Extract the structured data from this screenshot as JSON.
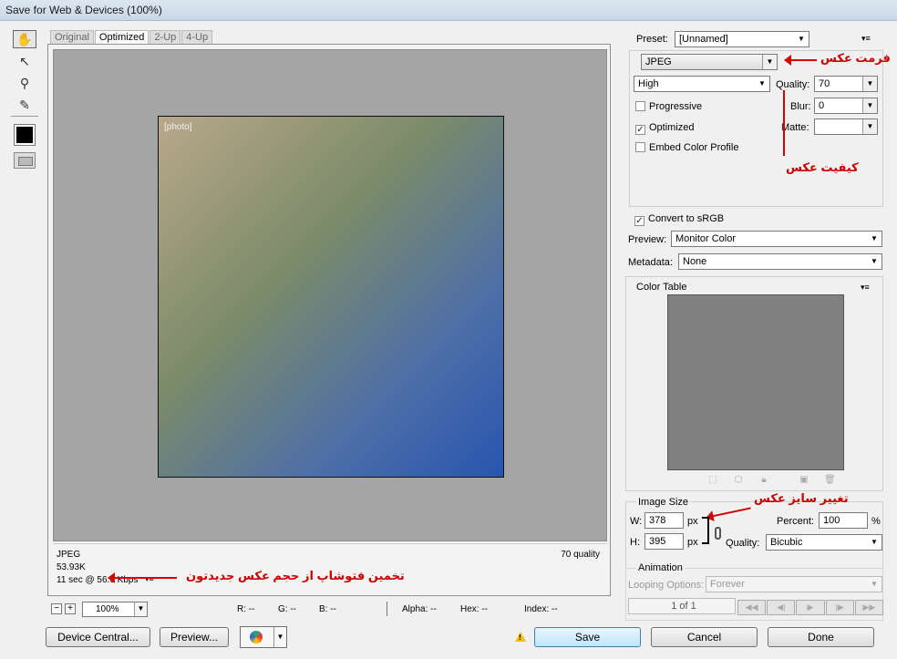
{
  "window": {
    "title": "Save for Web & Devices (100%)"
  },
  "tabs": [
    "Original",
    "Optimized",
    "2-Up",
    "4-Up"
  ],
  "tools": [
    "hand-tool-icon",
    "slice-select-tool-icon",
    "zoom-tool-icon",
    "eyedropper-tool-icon"
  ],
  "image_status": {
    "format": "JPEG",
    "size": "53.93K",
    "download": "11 sec @ 56.6 Kbps",
    "quality_label": "70 quality"
  },
  "annotations": {
    "format": "فرمت عکس",
    "quality": "کیفیت عکس",
    "resize": "تغییر سایز عکس",
    "estimate": "تخمین فتوشاپ از حجم عکس جدیدتون"
  },
  "zoom": {
    "value": "100%"
  },
  "pixel_info": {
    "r": "R: --",
    "g": "G: --",
    "b": "B: --",
    "alpha": "Alpha: --",
    "hex": "Hex: --",
    "index": "Index: --"
  },
  "buttons": {
    "device_central": "Device Central...",
    "preview": "Preview...",
    "save": "Save",
    "cancel": "Cancel",
    "done": "Done"
  },
  "preset": {
    "label": "Preset:",
    "value": "[Unnamed]"
  },
  "settings": {
    "format": "JPEG",
    "quality_preset": "High",
    "quality_label": "Quality:",
    "quality": "70",
    "blur_label": "Blur:",
    "blur": "0",
    "matte_label": "Matte:",
    "progressive": {
      "label": "Progressive",
      "checked": false
    },
    "optimized": {
      "label": "Optimized",
      "checked": true
    },
    "embed_profile": {
      "label": "Embed Color Profile",
      "checked": false
    },
    "convert_srgb": {
      "label": "Convert to sRGB",
      "checked": true
    },
    "preview_label": "Preview:",
    "preview_value": "Monitor Color",
    "metadata_label": "Metadata:",
    "metadata_value": "None"
  },
  "color_table": {
    "title": "Color Table"
  },
  "image_size": {
    "title": "Image Size",
    "w_label": "W:",
    "w": "378",
    "h_label": "H:",
    "h": "395",
    "unit": "px",
    "percent_label": "Percent:",
    "percent": "100",
    "percent_unit": "%",
    "quality_label": "Quality:",
    "quality_value": "Bicubic"
  },
  "animation": {
    "title": "Animation",
    "looping_label": "Looping Options:",
    "looping_value": "Forever",
    "frame_counter": "1 of 1"
  }
}
